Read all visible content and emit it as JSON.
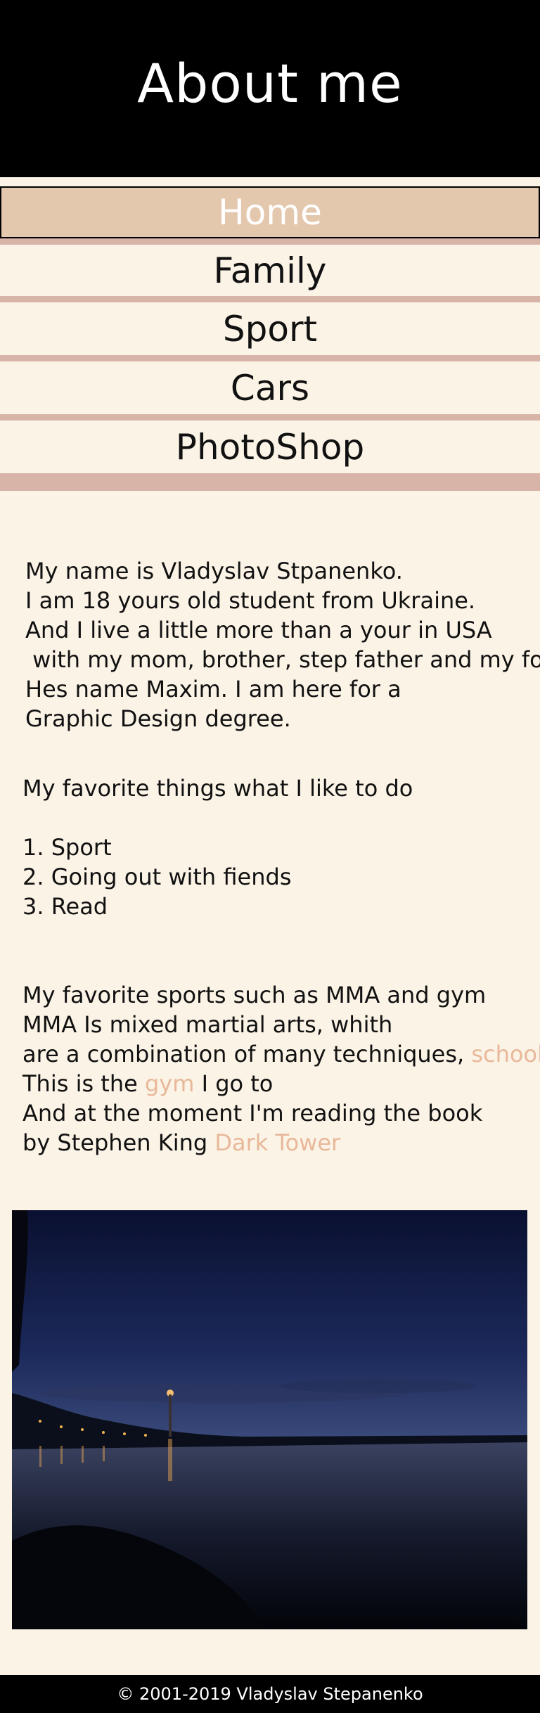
{
  "header": {
    "title": "About me"
  },
  "nav": [
    {
      "label": "Home"
    },
    {
      "label": "Family"
    },
    {
      "label": "Sport"
    },
    {
      "label": "Cars"
    },
    {
      "label": "PhotoShop"
    }
  ],
  "intro": {
    "lines": [
      "My name is Vladyslav Stpanenko.",
      "I am 18 yours old student from Ukraine.",
      "And I live a little more than a your in USA",
      " with my mom, brother, step father and my fog,",
      "Hes name Maxim. I am here for a",
      "Graphic Design degree."
    ]
  },
  "favorites": {
    "heading": "My favorite things what I like to do",
    "items": [
      "1. Sport",
      "2. Going out with fiends",
      "3. Read"
    ]
  },
  "sports": {
    "line1": "My favorite sports such as MMA and gym",
    "line2": "MMA Is mixed martial arts, whith",
    "line3_text": "are a combination of many techniques, ",
    "line3_link": "schools and",
    "line4_pre": "This is the ",
    "line4_link": "gym",
    "line4_post": " I go to",
    "line5": "And at the moment I'm reading the book",
    "line6_pre": "by Stephen King ",
    "line6_link": "Dark Tower"
  },
  "footer": {
    "text": "© 2001-2019 Vladyslav Stepanenko"
  },
  "colors": {
    "header_bg": "#000000",
    "page_bg": "#fbf3e6",
    "nav_active_bg": "#e4c8ae",
    "separator": "#d8b4a8",
    "link": "#e8b89a"
  }
}
